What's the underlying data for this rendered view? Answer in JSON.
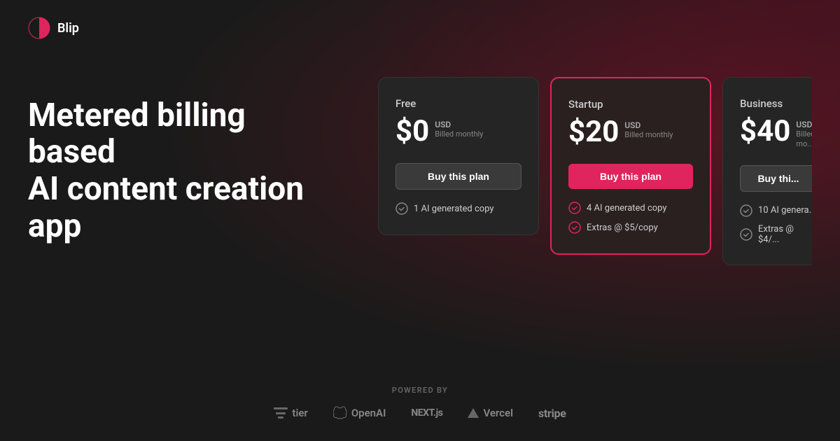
{
  "header": {
    "logo_text": "Blip"
  },
  "hero": {
    "title_line1": "Metered billing based",
    "title_line2": "AI content creation app"
  },
  "pricing": {
    "cards": [
      {
        "id": "free",
        "plan_name": "Free",
        "price": "$0",
        "currency": "USD",
        "period": "Billed monthly",
        "button_label": "Buy this plan",
        "button_type": "default",
        "highlighted": false,
        "features": [
          "1 AI generated copy"
        ]
      },
      {
        "id": "startup",
        "plan_name": "Startup",
        "price": "$20",
        "currency": "USD",
        "period": "Billed monthly",
        "button_label": "Buy this plan",
        "button_type": "primary",
        "highlighted": true,
        "features": [
          "4 AI generated copy",
          "Extras @ $5/copy"
        ]
      },
      {
        "id": "business",
        "plan_name": "Business",
        "price": "$40",
        "currency": "USD",
        "period": "Billed mo...",
        "button_label": "Buy thi...",
        "button_type": "default",
        "highlighted": false,
        "features": [
          "10 AI genera...",
          "Extras @ $4/..."
        ]
      }
    ]
  },
  "footer": {
    "powered_by_label": "POWERED BY",
    "logos": [
      {
        "name": "tier",
        "display": "tier"
      },
      {
        "name": "openai",
        "display": "OpenAI"
      },
      {
        "name": "nextjs",
        "display": "NEXT.js"
      },
      {
        "name": "vercel",
        "display": "Vercel"
      },
      {
        "name": "stripe",
        "display": "stripe"
      }
    ]
  }
}
